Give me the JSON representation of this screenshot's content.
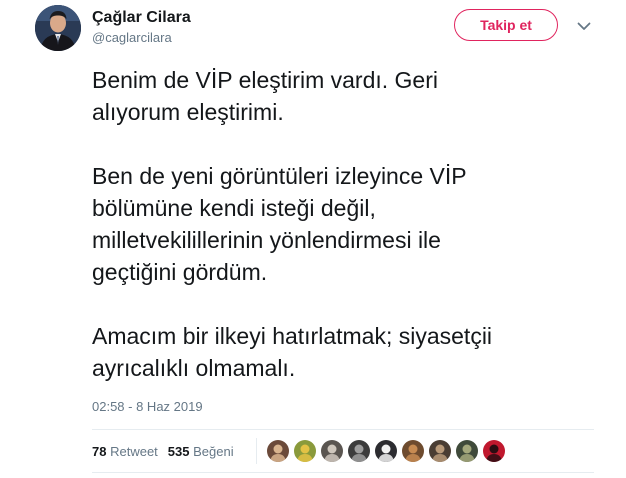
{
  "author": {
    "display_name": "Çağlar Cilara",
    "handle": "@caglarcilara",
    "avatar_icon": "profile-photo"
  },
  "follow_button": {
    "label": "Takip et",
    "color": "#e0245e"
  },
  "menu_icon": "chevron-down-icon",
  "tweet": {
    "paragraphs": [
      "Benim de VİP eleştirim vardı. Geri\nalıyorum eleştirimi.",
      "Ben de yeni görüntüleri izleyince VİP\nbölümüne kendi isteği değil,\nmilletvekilillerinin yönlendirmesi ile\ngeçtiğini gördüm.",
      "Amacım bir ilkeyi hatırlatmak; siyasetçii\nayrıcalıklı olmamalı."
    ],
    "timestamp": "02:58 - 8 Haz 2019"
  },
  "stats": {
    "retweet_count": "78",
    "retweet_label": "Retweet",
    "like_count": "535",
    "like_label": "Beğeni"
  },
  "likers": [
    {
      "bg": "#6b4a3a",
      "fg": "#d9b48f"
    },
    {
      "bg": "#8a9a3b",
      "fg": "#e3c245"
    },
    {
      "bg": "#5a5550",
      "fg": "#cfc7bd"
    },
    {
      "bg": "#3c3c3c",
      "fg": "#9e9e9e"
    },
    {
      "bg": "#2c2c30",
      "fg": "#f2f2f2"
    },
    {
      "bg": "#6e4b2e",
      "fg": "#c78b52"
    },
    {
      "bg": "#4a3d33",
      "fg": "#b99a7a"
    },
    {
      "bg": "#3f4a3a",
      "fg": "#a4a87c"
    },
    {
      "bg": "#c0182e",
      "fg": "#2a0d12"
    }
  ]
}
